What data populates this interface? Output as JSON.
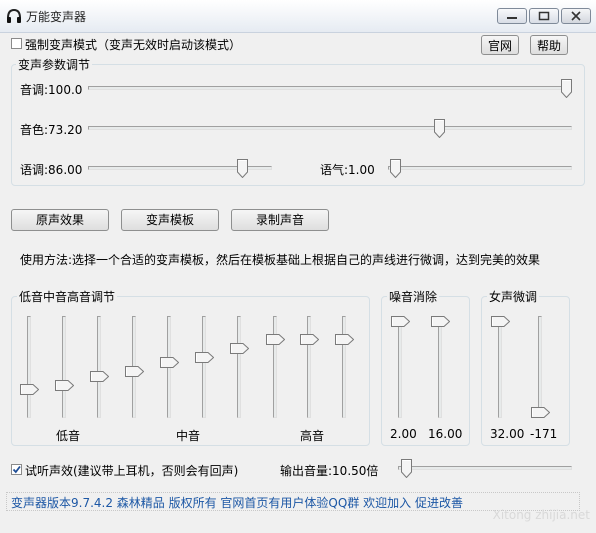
{
  "window": {
    "title": "万能变声器",
    "controls": {
      "minimize": "minimize-icon",
      "maximize": "maximize-icon",
      "close": "close-icon"
    }
  },
  "top": {
    "force_mode_label": "强制变声模式（变声无效时启动该模式）",
    "force_mode_checked": false,
    "official_site_button": "官网",
    "help_button": "帮助"
  },
  "params": {
    "group_title": "变声参数调节",
    "pitch": {
      "label": "音调:100.0",
      "value": 100.0,
      "max": 100
    },
    "timbre": {
      "label": "音色:73.20",
      "value": 73.2,
      "max": 100
    },
    "speed": {
      "label": "语调:86.00",
      "value": 86.0,
      "max": 100
    },
    "tone": {
      "label": "语气:1.00",
      "value": 1.0,
      "max": 100
    }
  },
  "buttons": {
    "original": "原声效果",
    "template": "变声模板",
    "record": "录制声音"
  },
  "usage_text": "使用方法:选择一个合适的变声模板，然后在模板基础上根据自己的声线进行微调，达到完美的效果",
  "eq": {
    "group_title": "低音中音高音调节",
    "bands": [
      0.25,
      0.3,
      0.4,
      0.45,
      0.55,
      0.6,
      0.7,
      0.8,
      0.8,
      0.8
    ],
    "low_label": "低音",
    "mid_label": "中音",
    "high_label": "高音"
  },
  "noise": {
    "group_title": "噪音消除",
    "sliders": [
      {
        "label": "2.00",
        "level": 1.0
      },
      {
        "label": "16.00",
        "level": 1.0
      }
    ]
  },
  "female": {
    "group_title": "女声微调",
    "sliders": [
      {
        "label": "32.00",
        "level": 1.0
      },
      {
        "label": "-171",
        "level": 0.0
      }
    ]
  },
  "bottom": {
    "preview_label": "试听声效(建议带上耳机，否则会有回声)",
    "preview_checked": true,
    "volume_label": "输出音量:10.50倍",
    "volume_level": 0.02
  },
  "footer": {
    "text": "变声器版本9.7.4.2   森林精品 版权所有   官网首页有用户体验QQ群 欢迎加入 促进改善"
  },
  "watermark": "Xitong zhijia.net",
  "colors": {
    "accent_blue": "#1c57a5",
    "check_blue": "#1f4e96"
  }
}
